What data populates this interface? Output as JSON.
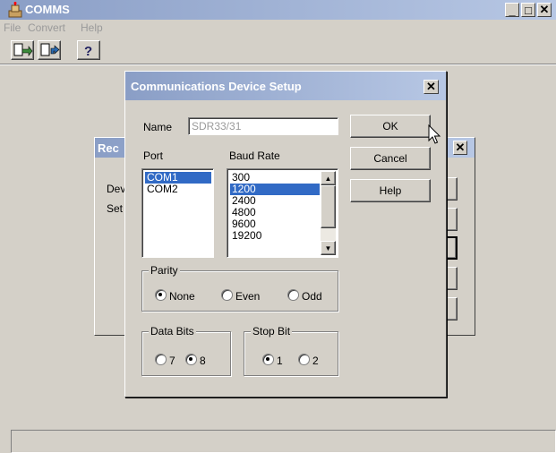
{
  "main_window": {
    "title": "COMMS",
    "menu": [
      "File",
      "Convert",
      "Help"
    ],
    "controls": {
      "minimize": "_",
      "maximize": "□",
      "close": "✕"
    }
  },
  "background_dialog": {
    "title_fragment": "Rec",
    "labels": [
      "Dev",
      "Set"
    ]
  },
  "setup_dialog": {
    "title": "Communications Device Setup",
    "name_label": "Name",
    "name_value": "SDR33/31",
    "port_label": "Port",
    "ports": [
      "COM1",
      "COM2"
    ],
    "port_selected": "COM1",
    "baud_label": "Baud Rate",
    "baud_rates": [
      "300",
      "1200",
      "2400",
      "4800",
      "9600",
      "19200"
    ],
    "baud_selected": "1200",
    "buttons": {
      "ok": "OK",
      "cancel": "Cancel",
      "help": "Help"
    },
    "parity": {
      "label": "Parity",
      "options": [
        "None",
        "Even",
        "Odd"
      ],
      "selected": "None"
    },
    "data_bits": {
      "label": "Data Bits",
      "options": [
        "7",
        "8"
      ],
      "selected": "8"
    },
    "stop_bit": {
      "label": "Stop Bit",
      "options": [
        "1",
        "2"
      ],
      "selected": "1"
    }
  },
  "colors": {
    "selection": "#316ac5",
    "dialog_face": "#d4d0c8",
    "titlebar": "#8a9ec6"
  }
}
